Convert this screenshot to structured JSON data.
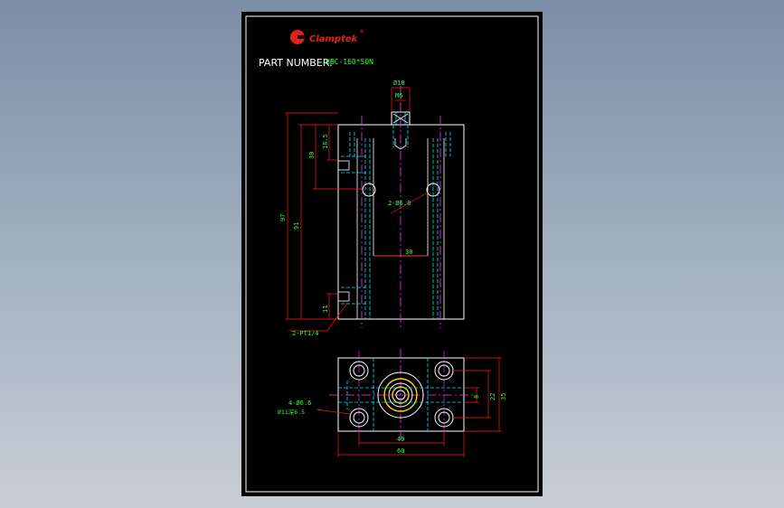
{
  "drawing": {
    "logo_text": "Clamptek",
    "logo_mark": "®",
    "part_number_label": "PART NUMBER:",
    "part_number_value": "HBC-160*50N",
    "colors": {
      "background": "#000000",
      "outline": "#ffffff",
      "dimension": "#ff1a1a",
      "dim_text": "#33ff33",
      "hidden": "#00e5ff",
      "center": "#ff33ff",
      "logo": "#e8201a"
    },
    "front_view": {
      "dims": {
        "top_dia": "Ø10",
        "thread": "M6",
        "d_16_5": "16.5",
        "d_30_vert": "30",
        "d_91": "91",
        "d_97": "97",
        "d_11": "11",
        "d_30_horiz": "30",
        "hole_note": "2-Ø6.8",
        "port_note": "2-PT1/4"
      }
    },
    "plan_view": {
      "dims": {
        "d_8": "8",
        "d_22": "22",
        "d_35": "35",
        "d_40": "40",
        "d_60": "60",
        "bolt_note": "4-Ø6.6",
        "cbore_note": "Ø11深6.5"
      }
    }
  }
}
